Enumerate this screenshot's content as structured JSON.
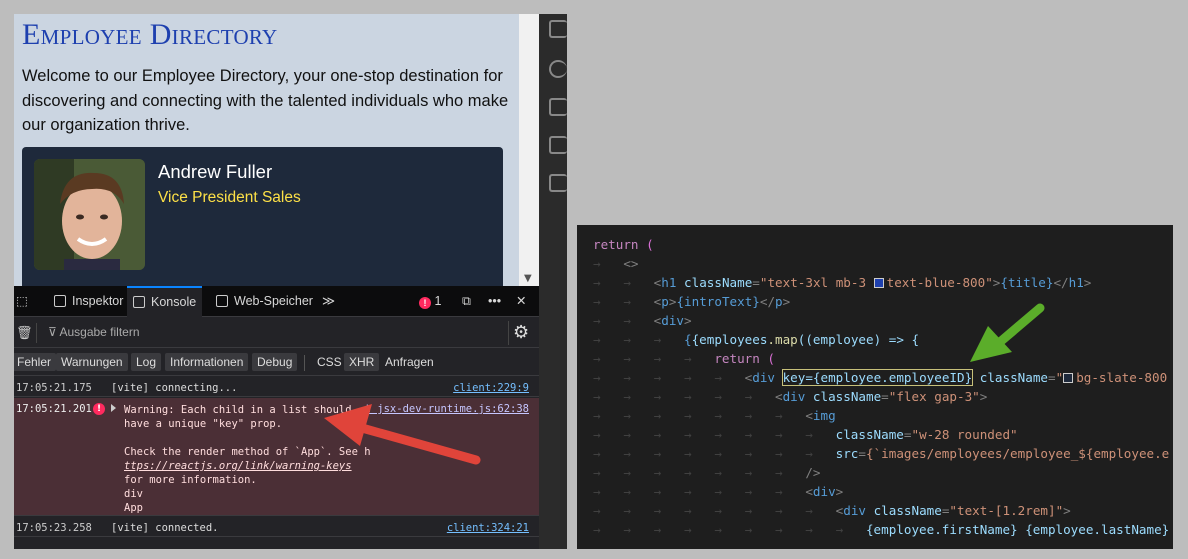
{
  "app": {
    "title": "Employee Directory",
    "intro": "Welcome to our Employee Directory, your one-stop destination for discovering and connecting with the talented individuals who make our organization thrive.",
    "employee": {
      "name": "Andrew Fuller",
      "title": "Vice President Sales"
    }
  },
  "devtools": {
    "tabs": [
      "Inspektor",
      "Konsole",
      "Web-Speicher"
    ],
    "error_count": "1",
    "filter_placeholder": "Ausgabe filtern",
    "categories": [
      "Fehler",
      "Warnungen",
      "Log",
      "Informationen",
      "Debug",
      "CSS",
      "XHR",
      "Anfragen"
    ],
    "rows": [
      {
        "time": "17:05:21.175",
        "message": "[vite] connecting...",
        "source": "client:229:9"
      },
      {
        "time": "17:05:21.201",
        "source": "…t jsx-dev-runtime.js:62:38",
        "warning_lines": [
          "Warning: Each child in a list should",
          "have a unique \"key\" prop.",
          "",
          "Check the render method of `App`. See h",
          "",
          "for more information.",
          "div",
          "App"
        ],
        "link": "ttps://reactjs.org/link/warning-keys"
      },
      {
        "time": "17:05:23.258",
        "message": "[vite] connected.",
        "source": "client:324:21"
      }
    ]
  },
  "code": {
    "lines": {
      "l1_kw": "return",
      "l1_p": " (",
      "l2": "<>",
      "l3_tag": "h1",
      "l3_attr": "className",
      "l3_val": "text-3xl mb-3 ",
      "l3_val2": "text-blue-800\"",
      "l3_expr": "{title}",
      "l4_tag": "p",
      "l4_expr": "{introText}",
      "l5_tag": "div",
      "l6_a": "{employees",
      "l6_b": ".map",
      "l6_c": "((employee) => {",
      "l7_kw": "return",
      "l7_p": " (",
      "l8_tag": "div",
      "l8_key": "key={employee.employeeID}",
      "l8_attr": "className",
      "l8_val": "bg-slate-800",
      "l9_tag": "div",
      "l9_attr": "className",
      "l9_val": "\"flex gap-3\"",
      "l10_tag": "img",
      "l11_attr": "className",
      "l11_val": "\"w-28 rounded\"",
      "l12_attr": "src",
      "l12_val": "{`images/employees/employee_${employee.e",
      "l13": "/>",
      "l14_tag": "div",
      "l15_tag": "div",
      "l15_attr": "className",
      "l15_val": "\"text-[1.2rem]\"",
      "l16": "{employee.firstName} {employee.lastName}"
    }
  }
}
